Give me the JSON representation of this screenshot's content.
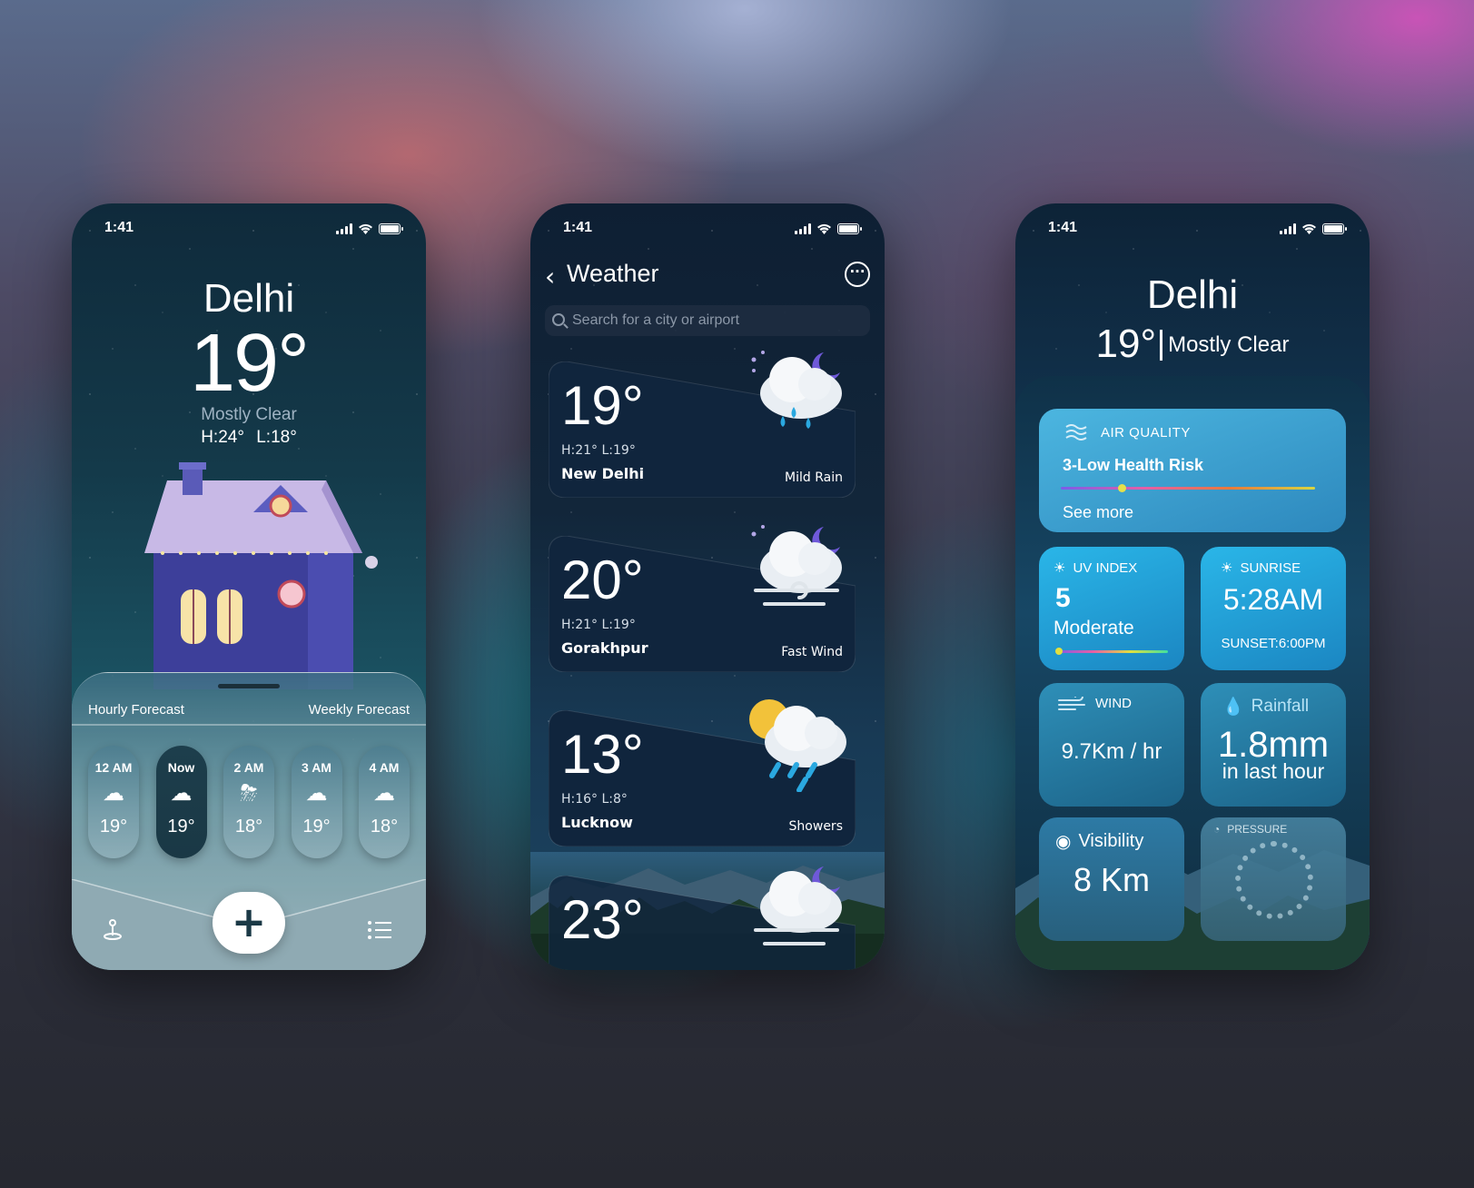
{
  "status": {
    "time": "1:41"
  },
  "screen1": {
    "city": "Delhi",
    "temp": "19°",
    "condition": "Mostly Clear",
    "high": "H:24°",
    "low": "L:18°",
    "tabs": {
      "hourly": "Hourly Forecast",
      "weekly": "Weekly Forecast"
    },
    "hours": [
      {
        "label": "12 AM",
        "icon": "moon-cloud-icon",
        "temp": "19°"
      },
      {
        "label": "Now",
        "icon": "moon-cloud-icon",
        "temp": "19°"
      },
      {
        "label": "2 AM",
        "icon": "storm-cloud-icon",
        "temp": "18°"
      },
      {
        "label": "3 AM",
        "icon": "moon-rain-cloud-icon",
        "temp": "19°"
      },
      {
        "label": "4 AM",
        "icon": "moon-rain-cloud-icon",
        "temp": "18°"
      }
    ],
    "tabbar": {
      "add_label": "+"
    }
  },
  "screen2": {
    "title": "Weather",
    "search_placeholder": "Search for a city or airport",
    "cards": [
      {
        "temp": "19°",
        "hl": "H:21° L:19°",
        "city": "New Delhi",
        "condition": "Mild Rain",
        "icon": "moon-rain-cloud-icon"
      },
      {
        "temp": "20°",
        "hl": "H:21° L:19°",
        "city": "Gorakhpur",
        "condition": "Fast Wind",
        "icon": "moon-wind-cloud-icon"
      },
      {
        "temp": "13°",
        "hl": "H:16° L:8°",
        "city": "Lucknow",
        "condition": "Showers",
        "icon": "sun-rain-cloud-icon"
      },
      {
        "temp": "23°",
        "hl": "",
        "city": "",
        "condition": "",
        "icon": "moon-wind-cloud-icon"
      }
    ]
  },
  "screen3": {
    "city": "Delhi",
    "temp": "19°",
    "condition": "Mostly Clear",
    "air_quality": {
      "header": "AIR QUALITY",
      "value": "3-Low Health Risk",
      "link": "See more",
      "level": 0.24
    },
    "uv": {
      "header": "UV INDEX",
      "value": "5",
      "level": "Moderate"
    },
    "sunrise": {
      "header": "SUNRISE",
      "value": "5:28AM",
      "sunset": "SUNSET:6:00PM"
    },
    "wind": {
      "header": "WIND",
      "value": "9.7Km",
      "unit": "hr"
    },
    "rainfall": {
      "header": "Rainfall",
      "value": "1.8mm",
      "detail": "in last hour"
    },
    "visibility": {
      "header": "Visibility",
      "value": "8 Km"
    },
    "pressure": {
      "header": "PRESSURE"
    }
  },
  "colors": {
    "accent": "#2ab6e8",
    "dark": "#0f2a3b",
    "aq_dot": "#e6e04a"
  }
}
